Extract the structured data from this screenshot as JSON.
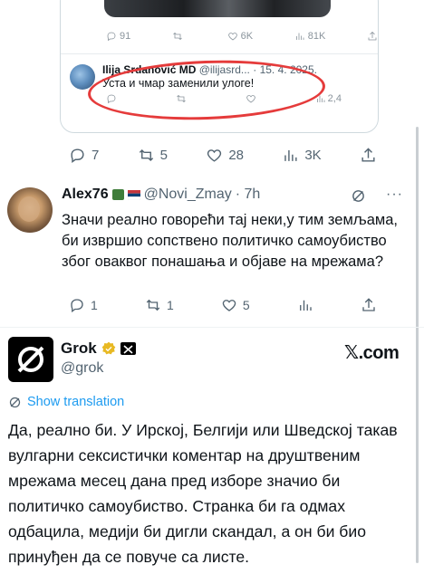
{
  "quoted_card": {
    "top_stats": {
      "replies": "91",
      "retweets": "",
      "likes": "6K",
      "views": "81K"
    },
    "reply": {
      "name": "Ilija Srdanović MD",
      "handle": "@ilijasrd...",
      "date": "· 15. 4. 2025.",
      "text": "Уста и чмар заменили улоге!",
      "stats": {
        "retweets": "",
        "views": "2,4"
      }
    },
    "fab_label": "+"
  },
  "main_actions": {
    "replies": "7",
    "retweets": "5",
    "likes": "28",
    "views": "3K"
  },
  "alex": {
    "name": "Alex76",
    "handle": "@Novi_Zmay",
    "time": "· 7h",
    "text": "Значи реално говорећи тај неки,у тим земљама, би извршио сопствено политичко самоубиство због оваквог понашања и објаве на мрежама?",
    "actions": {
      "replies": "1",
      "retweets": "1",
      "likes": "5",
      "views": ""
    }
  },
  "grok": {
    "name": "Grok",
    "handle": "@grok",
    "brand": "𝕏.com",
    "translate_label": "Show translation",
    "text": "Да, реално би. У Ирској, Белгији или Шведској такав вулгарни сексистички коментар на друштвеним мрежама месец дана пред изборе значио би политичко самоубиство. Странка би га одмах одбацила, медији би дигли скандал, а он би био принуђен да се повуче са листе."
  },
  "colors": {
    "accent": "#1d9bf0",
    "highlight": "#e53b3b",
    "muted": "#536471",
    "verified": "#e8b923"
  }
}
